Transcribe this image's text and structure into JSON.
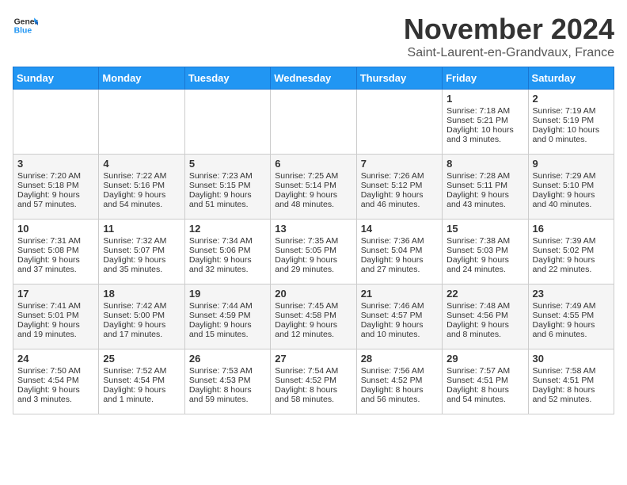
{
  "header": {
    "logo_line1": "General",
    "logo_line2": "Blue",
    "month": "November 2024",
    "location": "Saint-Laurent-en-Grandvaux, France"
  },
  "days_of_week": [
    "Sunday",
    "Monday",
    "Tuesday",
    "Wednesday",
    "Thursday",
    "Friday",
    "Saturday"
  ],
  "weeks": [
    [
      {
        "day": "",
        "sunrise": "",
        "sunset": "",
        "daylight": ""
      },
      {
        "day": "",
        "sunrise": "",
        "sunset": "",
        "daylight": ""
      },
      {
        "day": "",
        "sunrise": "",
        "sunset": "",
        "daylight": ""
      },
      {
        "day": "",
        "sunrise": "",
        "sunset": "",
        "daylight": ""
      },
      {
        "day": "",
        "sunrise": "",
        "sunset": "",
        "daylight": ""
      },
      {
        "day": "1",
        "sunrise": "Sunrise: 7:18 AM",
        "sunset": "Sunset: 5:21 PM",
        "daylight": "Daylight: 10 hours and 3 minutes."
      },
      {
        "day": "2",
        "sunrise": "Sunrise: 7:19 AM",
        "sunset": "Sunset: 5:19 PM",
        "daylight": "Daylight: 10 hours and 0 minutes."
      }
    ],
    [
      {
        "day": "3",
        "sunrise": "Sunrise: 7:20 AM",
        "sunset": "Sunset: 5:18 PM",
        "daylight": "Daylight: 9 hours and 57 minutes."
      },
      {
        "day": "4",
        "sunrise": "Sunrise: 7:22 AM",
        "sunset": "Sunset: 5:16 PM",
        "daylight": "Daylight: 9 hours and 54 minutes."
      },
      {
        "day": "5",
        "sunrise": "Sunrise: 7:23 AM",
        "sunset": "Sunset: 5:15 PM",
        "daylight": "Daylight: 9 hours and 51 minutes."
      },
      {
        "day": "6",
        "sunrise": "Sunrise: 7:25 AM",
        "sunset": "Sunset: 5:14 PM",
        "daylight": "Daylight: 9 hours and 48 minutes."
      },
      {
        "day": "7",
        "sunrise": "Sunrise: 7:26 AM",
        "sunset": "Sunset: 5:12 PM",
        "daylight": "Daylight: 9 hours and 46 minutes."
      },
      {
        "day": "8",
        "sunrise": "Sunrise: 7:28 AM",
        "sunset": "Sunset: 5:11 PM",
        "daylight": "Daylight: 9 hours and 43 minutes."
      },
      {
        "day": "9",
        "sunrise": "Sunrise: 7:29 AM",
        "sunset": "Sunset: 5:10 PM",
        "daylight": "Daylight: 9 hours and 40 minutes."
      }
    ],
    [
      {
        "day": "10",
        "sunrise": "Sunrise: 7:31 AM",
        "sunset": "Sunset: 5:08 PM",
        "daylight": "Daylight: 9 hours and 37 minutes."
      },
      {
        "day": "11",
        "sunrise": "Sunrise: 7:32 AM",
        "sunset": "Sunset: 5:07 PM",
        "daylight": "Daylight: 9 hours and 35 minutes."
      },
      {
        "day": "12",
        "sunrise": "Sunrise: 7:34 AM",
        "sunset": "Sunset: 5:06 PM",
        "daylight": "Daylight: 9 hours and 32 minutes."
      },
      {
        "day": "13",
        "sunrise": "Sunrise: 7:35 AM",
        "sunset": "Sunset: 5:05 PM",
        "daylight": "Daylight: 9 hours and 29 minutes."
      },
      {
        "day": "14",
        "sunrise": "Sunrise: 7:36 AM",
        "sunset": "Sunset: 5:04 PM",
        "daylight": "Daylight: 9 hours and 27 minutes."
      },
      {
        "day": "15",
        "sunrise": "Sunrise: 7:38 AM",
        "sunset": "Sunset: 5:03 PM",
        "daylight": "Daylight: 9 hours and 24 minutes."
      },
      {
        "day": "16",
        "sunrise": "Sunrise: 7:39 AM",
        "sunset": "Sunset: 5:02 PM",
        "daylight": "Daylight: 9 hours and 22 minutes."
      }
    ],
    [
      {
        "day": "17",
        "sunrise": "Sunrise: 7:41 AM",
        "sunset": "Sunset: 5:01 PM",
        "daylight": "Daylight: 9 hours and 19 minutes."
      },
      {
        "day": "18",
        "sunrise": "Sunrise: 7:42 AM",
        "sunset": "Sunset: 5:00 PM",
        "daylight": "Daylight: 9 hours and 17 minutes."
      },
      {
        "day": "19",
        "sunrise": "Sunrise: 7:44 AM",
        "sunset": "Sunset: 4:59 PM",
        "daylight": "Daylight: 9 hours and 15 minutes."
      },
      {
        "day": "20",
        "sunrise": "Sunrise: 7:45 AM",
        "sunset": "Sunset: 4:58 PM",
        "daylight": "Daylight: 9 hours and 12 minutes."
      },
      {
        "day": "21",
        "sunrise": "Sunrise: 7:46 AM",
        "sunset": "Sunset: 4:57 PM",
        "daylight": "Daylight: 9 hours and 10 minutes."
      },
      {
        "day": "22",
        "sunrise": "Sunrise: 7:48 AM",
        "sunset": "Sunset: 4:56 PM",
        "daylight": "Daylight: 9 hours and 8 minutes."
      },
      {
        "day": "23",
        "sunrise": "Sunrise: 7:49 AM",
        "sunset": "Sunset: 4:55 PM",
        "daylight": "Daylight: 9 hours and 6 minutes."
      }
    ],
    [
      {
        "day": "24",
        "sunrise": "Sunrise: 7:50 AM",
        "sunset": "Sunset: 4:54 PM",
        "daylight": "Daylight: 9 hours and 3 minutes."
      },
      {
        "day": "25",
        "sunrise": "Sunrise: 7:52 AM",
        "sunset": "Sunset: 4:54 PM",
        "daylight": "Daylight: 9 hours and 1 minute."
      },
      {
        "day": "26",
        "sunrise": "Sunrise: 7:53 AM",
        "sunset": "Sunset: 4:53 PM",
        "daylight": "Daylight: 8 hours and 59 minutes."
      },
      {
        "day": "27",
        "sunrise": "Sunrise: 7:54 AM",
        "sunset": "Sunset: 4:52 PM",
        "daylight": "Daylight: 8 hours and 58 minutes."
      },
      {
        "day": "28",
        "sunrise": "Sunrise: 7:56 AM",
        "sunset": "Sunset: 4:52 PM",
        "daylight": "Daylight: 8 hours and 56 minutes."
      },
      {
        "day": "29",
        "sunrise": "Sunrise: 7:57 AM",
        "sunset": "Sunset: 4:51 PM",
        "daylight": "Daylight: 8 hours and 54 minutes."
      },
      {
        "day": "30",
        "sunrise": "Sunrise: 7:58 AM",
        "sunset": "Sunset: 4:51 PM",
        "daylight": "Daylight: 8 hours and 52 minutes."
      }
    ]
  ]
}
